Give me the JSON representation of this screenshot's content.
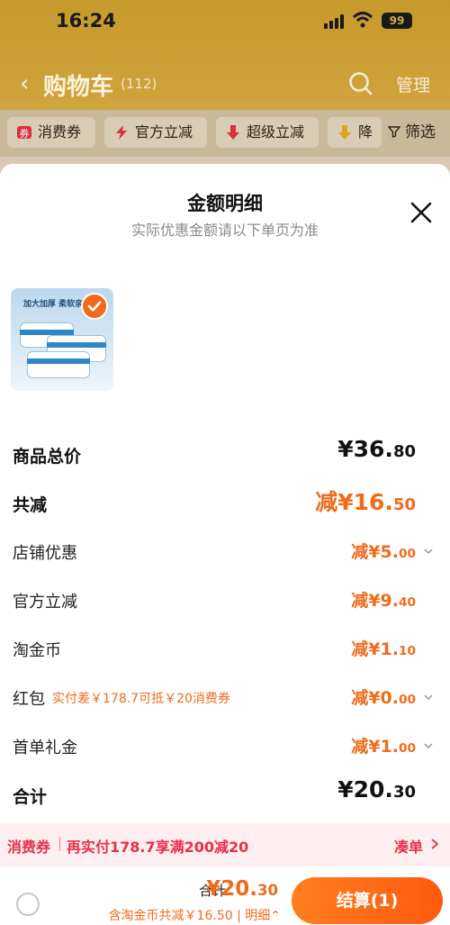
{
  "status_bar": {
    "time": "16:24",
    "battery": "99"
  },
  "navbar": {
    "back_glyph": "‹",
    "title": "购物车",
    "count": "(112)",
    "manage_label": "管理"
  },
  "filter_chips": [
    {
      "label": "消费券",
      "icon": "coupon-icon"
    },
    {
      "label": "官方立减",
      "icon": "lightning-icon"
    },
    {
      "label": "超级立减",
      "icon": "arrow-down-icon"
    },
    {
      "label": "降",
      "icon": "arrow-down-icon"
    }
  ],
  "filter_label": "筛选",
  "sheet": {
    "title": "金额明细",
    "subtitle": "实际优惠金额请以下单页为准",
    "product_label": "加大加厚 柔软亲",
    "rows": [
      {
        "label": "商品总价",
        "value": "¥36.",
        "value_small": "80",
        "kind": "total"
      },
      {
        "label": "共减",
        "value": "减¥16.",
        "value_small": "50",
        "kind": "reduction"
      },
      {
        "label": "店铺优惠",
        "value": "减¥5.",
        "value_small": "00",
        "expand": true
      },
      {
        "label": "官方立减",
        "value": "减¥9.",
        "value_small": "40"
      },
      {
        "label": "淘金币",
        "value": "减¥1.",
        "value_small": "10"
      },
      {
        "label": "红包",
        "note": "实付差￥178.7可抵￥20消费券",
        "value": "减¥0.",
        "value_small": "00",
        "expand": true
      },
      {
        "label": "首单礼金",
        "value": "减¥1.",
        "value_small": "00",
        "expand": true
      },
      {
        "label": "合计",
        "value": "¥20.",
        "value_small": "30",
        "kind": "total"
      }
    ],
    "promo": {
      "tag": "消费券",
      "text": "再实付178.7享满200减20",
      "action": "凑单"
    },
    "bottom": {
      "total_label": "合计:",
      "total_value": "¥20.",
      "total_value_small": "30",
      "note": "含淘金币共减￥16.50 | 明细⌃",
      "pay_label": "结算(1)"
    }
  },
  "colors": {
    "accent": "#f06b1c",
    "promo_red": "#e8304a",
    "header_gold": "#cfa23a"
  }
}
